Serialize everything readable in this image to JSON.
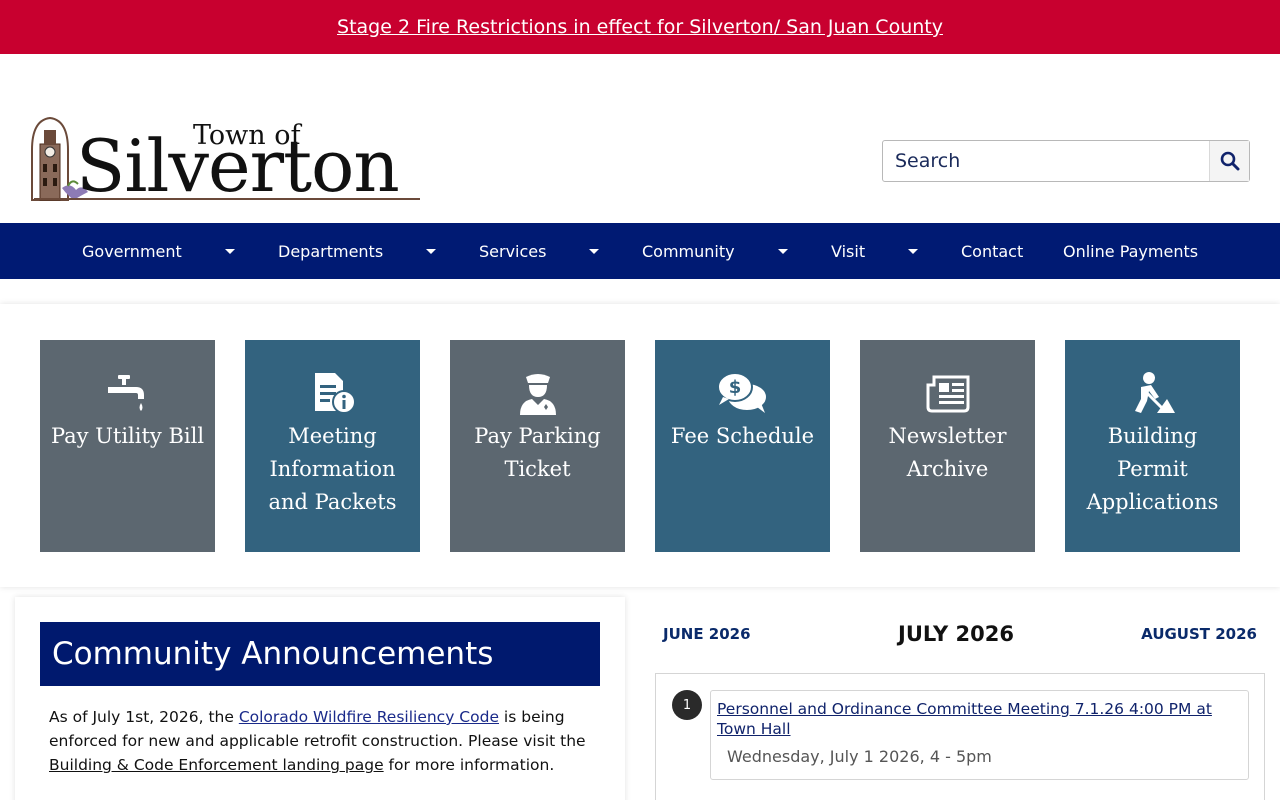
{
  "alert": {
    "text": "Stage 2 Fire Restrictions in effect for Silverton/ San Juan County"
  },
  "logo": {
    "town_of": "Town of",
    "name": "Silverton"
  },
  "search": {
    "placeholder": "Search"
  },
  "nav": {
    "items": [
      {
        "label": "Government",
        "has_dropdown": true
      },
      {
        "label": "Departments",
        "has_dropdown": true
      },
      {
        "label": "Services",
        "has_dropdown": true
      },
      {
        "label": "Community",
        "has_dropdown": true
      },
      {
        "label": "Visit",
        "has_dropdown": true
      },
      {
        "label": "Contact",
        "has_dropdown": false
      },
      {
        "label": "Online Payments",
        "has_dropdown": false
      }
    ]
  },
  "quick_links": [
    {
      "label": "Pay Utility Bill",
      "icon": "faucet-icon",
      "color": "#5c6770"
    },
    {
      "label": "Meeting Information and Packets",
      "icon": "file-info-icon",
      "color": "#33637f"
    },
    {
      "label": "Pay Parking Ticket",
      "icon": "police-officer-icon",
      "color": "#5c6770"
    },
    {
      "label": "Fee Schedule",
      "icon": "dollar-comments-icon",
      "color": "#33637f"
    },
    {
      "label": "Newsletter Archive",
      "icon": "newspaper-icon",
      "color": "#5c6770"
    },
    {
      "label": "Building Permit Applications",
      "icon": "digging-person-icon",
      "color": "#33637f"
    }
  ],
  "announcements": {
    "title": "Community Announcements",
    "p1_a": "As of July 1st, 2026, the ",
    "p1_link": "Colorado Wildfire Resiliency Code",
    "p1_b": " is being enforced for new and applicable retrofit construction. Please visit the ",
    "p1_link2": "Building & Code Enforcement landing page",
    "p1_c": " for more information."
  },
  "calendar": {
    "prev": "JUNE 2026",
    "current": "JULY 2026",
    "next": "AUGUST 2026",
    "events": [
      {
        "day": "1",
        "title": "Personnel and Ordinance Committee Meeting 7.1.26 4:00 PM at Town Hall",
        "when": "Wednesday, July 1 2026, 4 - 5pm"
      }
    ]
  }
}
